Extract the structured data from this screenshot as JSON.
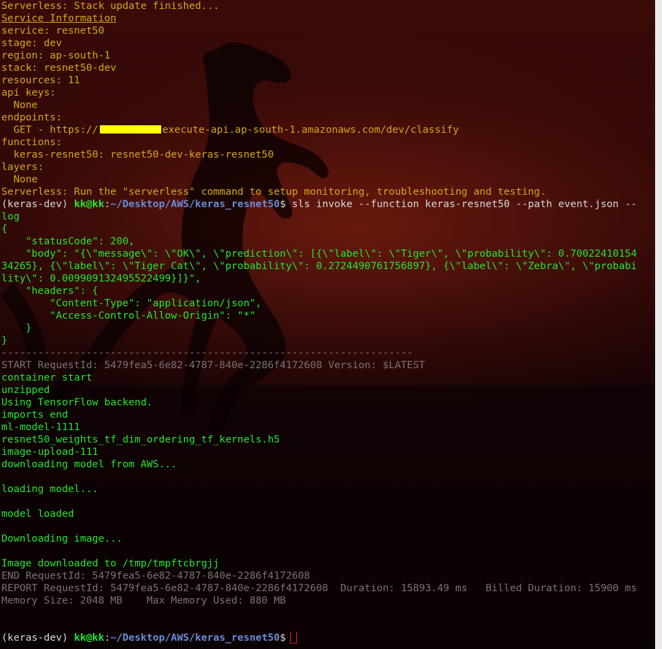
{
  "lines": [
    {
      "class": "y",
      "text": "Serverless: Stack update finished..."
    },
    {
      "class": "y u",
      "text": "Service Information"
    },
    {
      "class": "y",
      "text": "service: resnet50"
    },
    {
      "class": "y",
      "text": "stage: dev"
    },
    {
      "class": "y",
      "text": "region: ap-south-1"
    },
    {
      "class": "y",
      "text": "stack: resnet50-dev"
    },
    {
      "class": "y",
      "text": "resources: 11"
    },
    {
      "class": "y",
      "text": "api keys:"
    },
    {
      "class": "y",
      "text": "  None"
    },
    {
      "class": "y",
      "text": "endpoints:"
    },
    {
      "class": "y",
      "endpoint": true,
      "text": "  GET - https://",
      "text2": "execute-api.ap-south-1.amazonaws.com/dev/classify"
    },
    {
      "class": "y",
      "text": "functions:"
    },
    {
      "class": "y",
      "text": "  keras-resnet50: resnet50-dev-keras-resnet50"
    },
    {
      "class": "y",
      "text": "layers:"
    },
    {
      "class": "y",
      "text": "  None"
    },
    {
      "class": "y",
      "text": "Serverless: Run the \"serverless\" command to setup monitoring, troubleshooting and testing."
    },
    {
      "prompt": true,
      "env": "(keras-dev) ",
      "user": "kk@kk",
      "sep": ":",
      "path": "~/Desktop/AWS/keras_resnet50",
      "cmd": "$ sls invoke --function keras-resnet50 --path event.json --"
    },
    {
      "class": "g",
      "text": "log"
    },
    {
      "class": "g",
      "text": "{"
    },
    {
      "class": "g",
      "text": "    \"statusCode\": 200,"
    },
    {
      "class": "g",
      "text": "    \"body\": \"{\\\"message\\\": \\\"OK\\\", \\\"prediction\\\": [{\\\"label\\\": \\\"Tiger\\\", \\\"probability\\\": 0.70022410154"
    },
    {
      "class": "g",
      "text": "34265}, {\\\"label\\\": \\\"Tiger Cat\\\", \\\"probability\\\": 0.2724490761756897}, {\\\"label\\\": \\\"Zebra\\\", \\\"probabi"
    },
    {
      "class": "g",
      "text": "lity\\\": 0.009909132495522499}]}\","
    },
    {
      "class": "g",
      "text": "    \"headers\": {"
    },
    {
      "class": "g",
      "text": "        \"Content-Type\": \"application/json\","
    },
    {
      "class": "g",
      "text": "        \"Access-Control-Allow-Origin\": \"*\""
    },
    {
      "class": "g",
      "text": "    }"
    },
    {
      "class": "g",
      "text": "}"
    },
    {
      "class": "gr",
      "text": "--------------------------------------------------------------------"
    },
    {
      "class": "gr",
      "text": "START RequestId: 5479fea5-6e82-4787-840e-2286f4172608 Version: $LATEST"
    },
    {
      "class": "g",
      "text": "container start"
    },
    {
      "class": "g",
      "text": "unzipped"
    },
    {
      "class": "g",
      "text": "Using TensorFlow backend."
    },
    {
      "class": "g",
      "text": "imports end"
    },
    {
      "class": "g",
      "text": "ml-model-1111"
    },
    {
      "class": "g",
      "text": "resnet50_weights_tf_dim_ordering_tf_kernels.h5"
    },
    {
      "class": "g",
      "text": "image-upload-111"
    },
    {
      "class": "g",
      "text": "downloading model from AWS..."
    },
    {
      "class": "g",
      "text": ""
    },
    {
      "class": "g",
      "text": "loading model..."
    },
    {
      "class": "g",
      "text": ""
    },
    {
      "class": "g",
      "text": "model loaded"
    },
    {
      "class": "g",
      "text": ""
    },
    {
      "class": "g",
      "text": "Downloading image..."
    },
    {
      "class": "g",
      "text": ""
    },
    {
      "class": "g",
      "text": "Image downloaded to /tmp/tmpftcbrgjj"
    },
    {
      "class": "gr",
      "text": "END RequestId: 5479fea5-6e82-4787-840e-2286f4172608"
    },
    {
      "class": "gr",
      "text": "REPORT RequestId: 5479fea5-6e82-4787-840e-2286f4172608  Duration: 15893.49 ms   Billed Duration: 15900 ms"
    },
    {
      "class": "gr",
      "text": "Memory Size: 2048 MB    Max Memory Used: 880 MB"
    },
    {
      "class": "g",
      "text": ""
    },
    {
      "class": "g",
      "text": ""
    },
    {
      "prompt": true,
      "cursor": true,
      "env": "(keras-dev) ",
      "user": "kk@kk",
      "sep": ":",
      "path": "~/Desktop/AWS/keras_resnet50",
      "cmd": "$"
    }
  ],
  "colors": {
    "serverless_output": "#d6a61c",
    "stdout": "#22e82f",
    "log_meta": "#7c7373",
    "prompt_path": "#6a8bd6",
    "redaction": "#ffff00",
    "cursor": "#e02020"
  }
}
